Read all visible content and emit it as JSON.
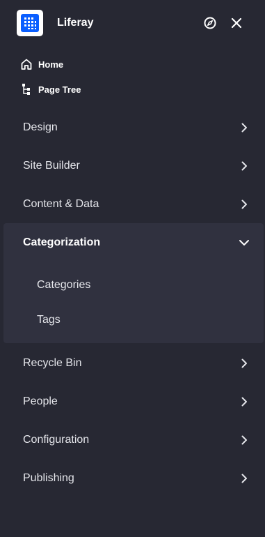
{
  "header": {
    "site_name": "Liferay",
    "logo_icon": "liferay-logo",
    "compass_icon": "compass-icon",
    "close_icon": "close-icon"
  },
  "quick_links": [
    {
      "label": "Home",
      "icon": "home-icon"
    },
    {
      "label": "Page Tree",
      "icon": "page-tree-icon"
    }
  ],
  "menu_top": [
    {
      "label": "Design",
      "expanded": false
    },
    {
      "label": "Site Builder",
      "expanded": false
    },
    {
      "label": "Content & Data",
      "expanded": false
    }
  ],
  "categorization": {
    "label": "Categorization",
    "expanded": true,
    "children": [
      {
        "label": "Categories"
      },
      {
        "label": "Tags"
      }
    ]
  },
  "menu_bottom": [
    {
      "label": "Recycle Bin",
      "expanded": false
    },
    {
      "label": "People",
      "expanded": false
    },
    {
      "label": "Configuration",
      "expanded": false
    },
    {
      "label": "Publishing",
      "expanded": false
    }
  ],
  "colors": {
    "background": "#272833",
    "active_block": "#30313f",
    "logo_blue": "#0b5fff",
    "text": "#e4e5ea"
  }
}
